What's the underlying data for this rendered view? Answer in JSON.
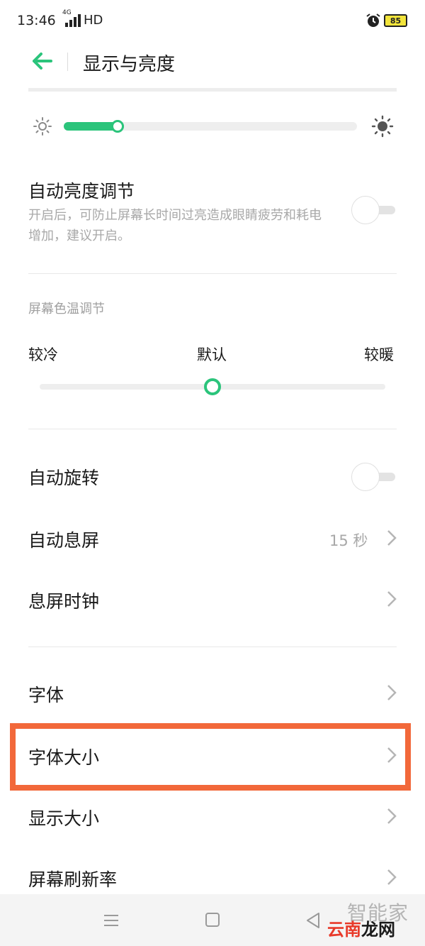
{
  "status_bar": {
    "time": "13:46",
    "network": "4G",
    "hd": "HD",
    "battery": "85"
  },
  "header": {
    "title": "显示与亮度"
  },
  "brightness": {
    "level": 0.18,
    "accent": "#2bc47b"
  },
  "auto_brightness": {
    "title": "自动亮度调节",
    "description": "开启后，可防止屏幕长时间过亮造成眼睛疲劳和耗电增加，建议开启。",
    "enabled": false
  },
  "color_temp": {
    "section_label": "屏幕色温调节",
    "cool_label": "较冷",
    "default_label": "默认",
    "warm_label": "较暖",
    "level": 0.5
  },
  "auto_rotate": {
    "title": "自动旋转",
    "enabled": false
  },
  "auto_screen_off": {
    "title": "自动息屏",
    "value": "15 秒"
  },
  "screen_off_clock": {
    "title": "息屏时钟"
  },
  "font": {
    "title": "字体"
  },
  "font_size": {
    "title": "字体大小",
    "highlight_color": "#f2683a"
  },
  "display_size": {
    "title": "显示大小"
  },
  "refresh_rate": {
    "title": "屏幕刷新率"
  },
  "watermark": {
    "line1": "智能家",
    "line2_a": "云南",
    "line2_b": "龙网"
  }
}
